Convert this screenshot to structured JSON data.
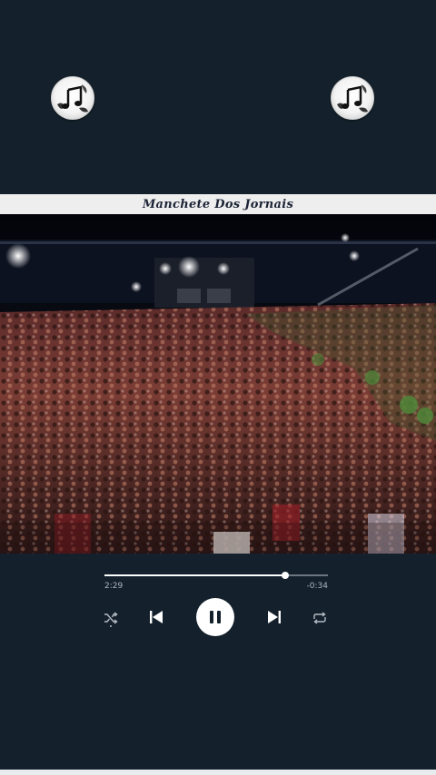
{
  "song": {
    "title": "Manchete Dos Jornais"
  },
  "player": {
    "elapsed": "2:29",
    "remaining": "-0:34",
    "progress_fraction": 0.81
  },
  "icons": {
    "left_badge": "music-note-icon",
    "right_badge": "music-note-icon",
    "shuffle": "shuffle-icon",
    "previous": "skip-previous-icon",
    "play_pause": "pause-icon",
    "next": "skip-next-icon",
    "repeat": "repeat-icon"
  },
  "colors": {
    "background": "#14202b",
    "title_bar": "#eeeeee",
    "title_text": "#1c2436",
    "accent": "#ffffff",
    "track": "#6c7581"
  }
}
